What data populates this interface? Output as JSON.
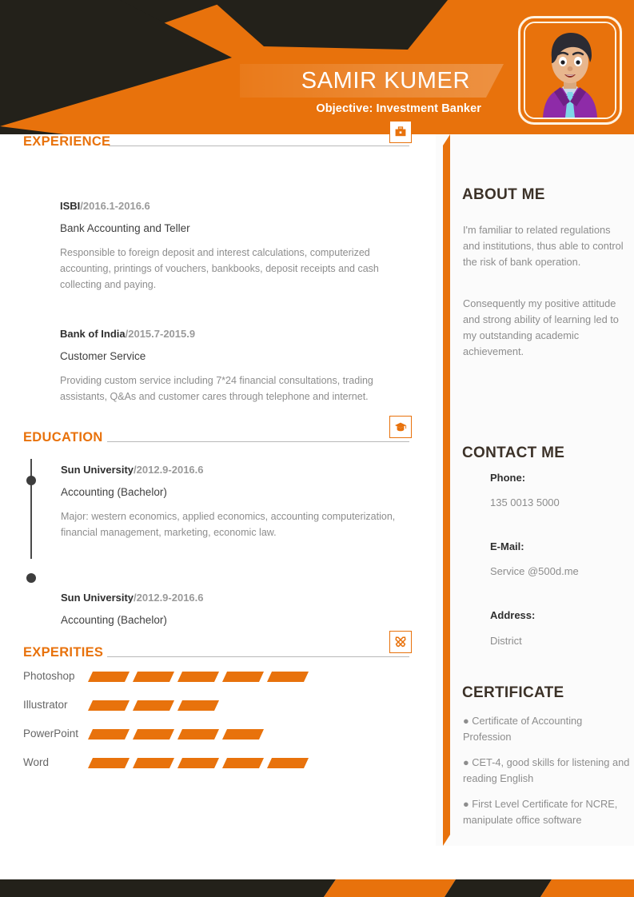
{
  "colors": {
    "orange": "#E8720C",
    "dark": "#23211A",
    "muted_text": "#8d8d8d",
    "heading_dark": "#3c3228"
  },
  "header": {
    "name": "SAMIR KUMER",
    "objective": "Objective: Investment Banker",
    "avatar_alt": "portrait-avatar"
  },
  "sections": {
    "experience": {
      "title": "EXPERIENCE",
      "icon": "briefcase-icon",
      "entries": [
        {
          "company": "ISBI",
          "dates": "/2016.1-2016.6",
          "role": "Bank Accounting and Teller",
          "description": "Responsible to foreign deposit and interest calculations, computerized accounting, printings of vouchers, bankbooks, deposit receipts and cash collecting and paying."
        },
        {
          "company": "Bank of India",
          "dates": "/2015.7-2015.9",
          "role": "Customer Service",
          "description": "Providing custom service including 7*24 financial consultations, trading assistants, Q&As and customer cares through telephone and internet."
        }
      ]
    },
    "education": {
      "title": "EDUCATION",
      "icon": "graduation-cap-icon",
      "entries": [
        {
          "school": "Sun University",
          "dates": "/2012.9-2016.6",
          "degree": "Accounting  (Bachelor)",
          "description": "Major: western economics, applied economics, accounting computerization, financial management, marketing, economic law."
        },
        {
          "school": "Sun University",
          "dates": "/2012.9-2016.6",
          "degree": "Accounting  (Bachelor)",
          "description": ""
        }
      ]
    },
    "experties": {
      "title": "EXPERITIES",
      "icon": "tools-icon",
      "skills": [
        {
          "name": "Photoshop",
          "segments": 5
        },
        {
          "name": "Illustrator",
          "segments": 3
        },
        {
          "name": "PowerPoint",
          "segments": 4
        },
        {
          "name": "Word",
          "segments": 5
        }
      ]
    }
  },
  "sidebar": {
    "about": {
      "title": "ABOUT ME",
      "paragraphs": [
        "I'm familiar to related regulations and institutions, thus able to control the risk of bank operation.",
        "Consequently my positive attitude and strong ability of learning led to my outstanding academic achievement."
      ]
    },
    "contact": {
      "title": "CONTACT ME",
      "fields": [
        {
          "label": "Phone:",
          "value": "135 0013 5000"
        },
        {
          "label": "E-Mail:",
          "value": "Service @500d.me"
        },
        {
          "label": "Address:",
          "value": "District"
        }
      ]
    },
    "certificate": {
      "title": "CERTIFICATE",
      "items": [
        "● Certificate of Accounting Profession",
        "● CET-4, good skills for listening and reading English",
        "● First Level Certificate for NCRE, manipulate office software"
      ]
    }
  }
}
